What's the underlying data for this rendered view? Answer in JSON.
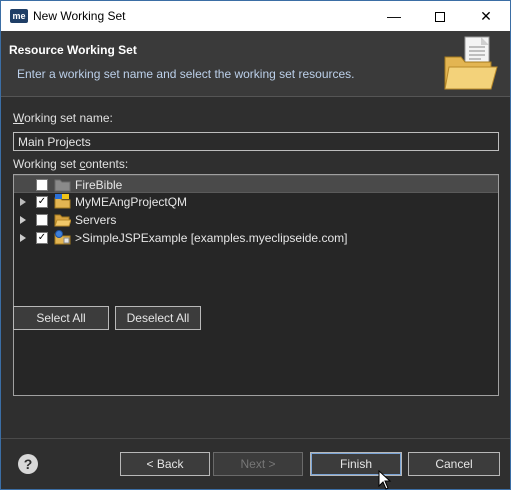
{
  "window": {
    "app_icon_text": "me",
    "title": "New Working Set",
    "minimize_glyph": "—",
    "close_glyph": "✕"
  },
  "header": {
    "title": "Resource Working Set",
    "description": "Enter a working set name and select the working set resources.",
    "graphic_icon": "folder-document-icon"
  },
  "form": {
    "name_label_prefix": "W",
    "name_label_rest": "orking set name:",
    "name_value": "Main Projects",
    "contents_label_prefix": "Working set ",
    "contents_label_accel": "c",
    "contents_label_rest": "ontents:"
  },
  "tree": {
    "rows": [
      {
        "label": "FireBible",
        "checked": false,
        "expandable": false,
        "selected": true,
        "icon": "closed-project-folder-icon"
      },
      {
        "label": "MyMEAngProjectQM",
        "checked": true,
        "expandable": true,
        "selected": false,
        "icon": "angular-project-folder-icon"
      },
      {
        "label": "Servers",
        "checked": false,
        "expandable": true,
        "selected": false,
        "icon": "open-folder-icon"
      },
      {
        "label": ">SimpleJSPExample   [examples.myeclipseide.com]",
        "checked": true,
        "expandable": true,
        "selected": false,
        "icon": "web-project-folder-icon"
      }
    ]
  },
  "buttons": {
    "select_all": "Select All",
    "deselect_all": "Deselect All",
    "back": "< Back",
    "next": "Next >",
    "finish": "Finish",
    "cancel": "Cancel"
  },
  "help": {
    "glyph": "?"
  },
  "colors": {
    "dialog_bg": "#2f2f2f",
    "header_bg": "#3a3a3a",
    "header_desc": "#bcd0ea",
    "default_button_focus": "#7aa4d6"
  }
}
